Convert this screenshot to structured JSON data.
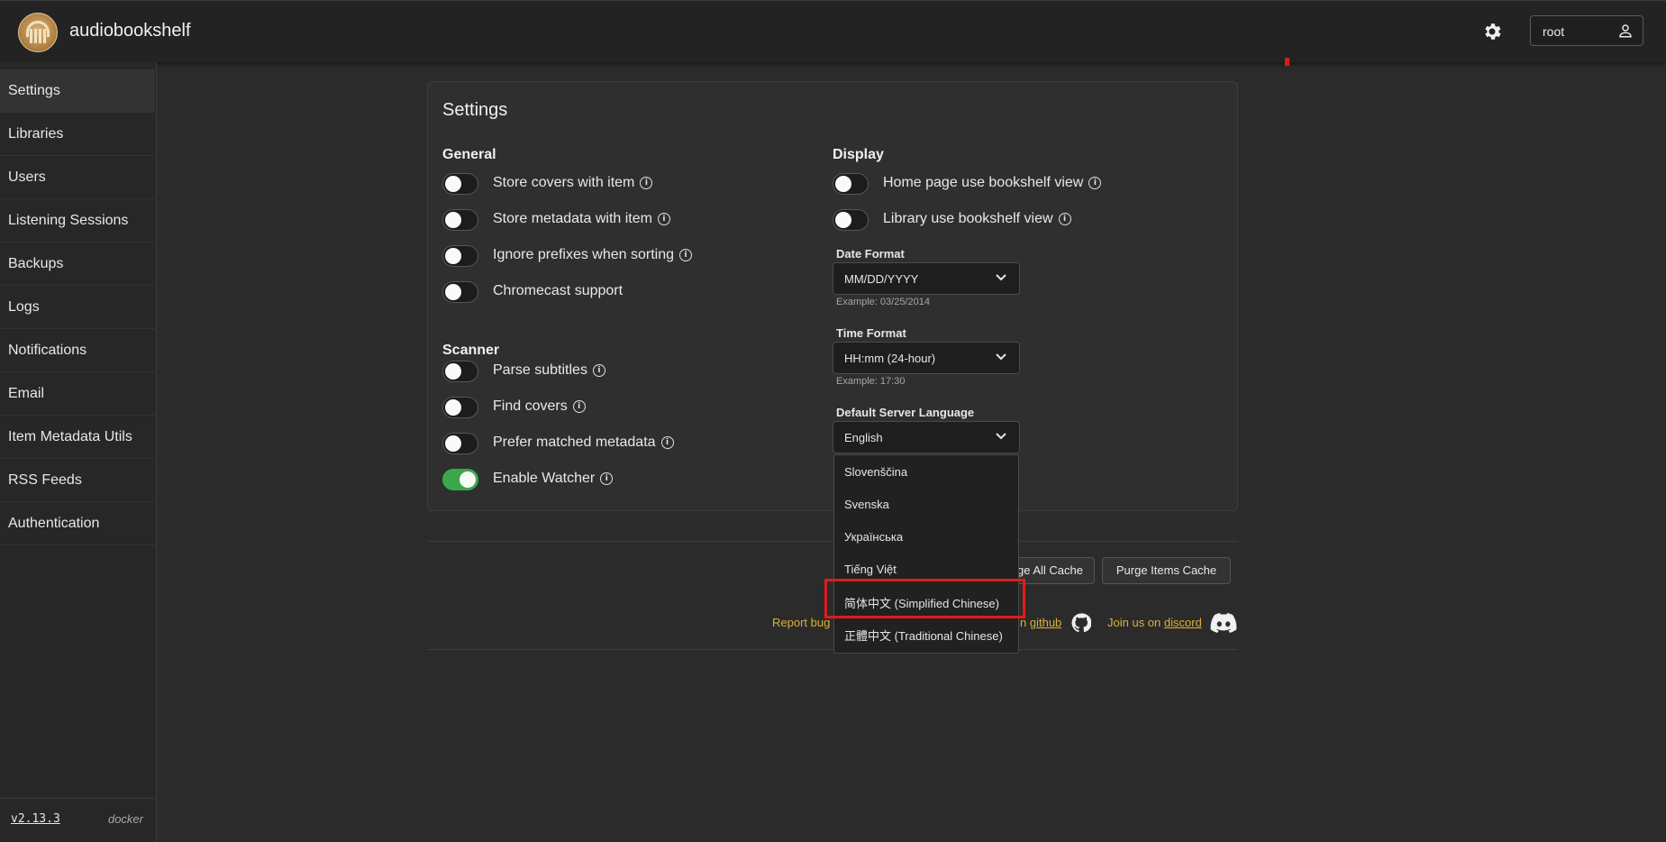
{
  "app": {
    "title": "audiobookshelf"
  },
  "header": {
    "username": "root",
    "settings_icon": "gear-icon",
    "user_icon": "user-icon"
  },
  "sidebar": {
    "items": [
      {
        "label": "Settings",
        "active": true
      },
      {
        "label": "Libraries"
      },
      {
        "label": "Users"
      },
      {
        "label": "Listening Sessions"
      },
      {
        "label": "Backups"
      },
      {
        "label": "Logs"
      },
      {
        "label": "Notifications"
      },
      {
        "label": "Email"
      },
      {
        "label": "Item Metadata Utils"
      },
      {
        "label": "RSS Feeds"
      },
      {
        "label": "Authentication"
      }
    ],
    "version": "v2.13.3",
    "install": "docker"
  },
  "settings": {
    "title": "Settings",
    "general": {
      "heading": "General",
      "items": [
        {
          "label": "Store covers with item",
          "on": false
        },
        {
          "label": "Store metadata with item",
          "on": false
        },
        {
          "label": "Ignore prefixes when sorting",
          "on": false
        },
        {
          "label": "Chromecast support",
          "on": false
        }
      ]
    },
    "scanner": {
      "heading": "Scanner",
      "items": [
        {
          "label": "Parse subtitles",
          "on": false
        },
        {
          "label": "Find covers",
          "on": false
        },
        {
          "label": "Prefer matched metadata",
          "on": false
        },
        {
          "label": "Enable Watcher",
          "on": true
        }
      ]
    },
    "display": {
      "heading": "Display",
      "items": [
        {
          "label": "Home page use bookshelf view",
          "on": false
        },
        {
          "label": "Library use bookshelf view",
          "on": false
        }
      ],
      "date_format": {
        "label": "Date Format",
        "value": "MM/DD/YYYY",
        "example": "Example: 03/25/2014"
      },
      "time_format": {
        "label": "Time Format",
        "value": "HH:mm (24-hour)",
        "example": "Example: 17:30"
      },
      "language": {
        "label": "Default Server Language",
        "value": "English",
        "options": [
          "Slovenščina",
          "Svenska",
          "Українська",
          "Tiếng Việt",
          "简体中文 (Simplified Chinese)",
          "正體中文 (Traditional Chinese)"
        ]
      }
    }
  },
  "actions": {
    "purge_all_partial": "ge All Cache",
    "purge_items": "Purge Items Cache"
  },
  "footer": {
    "report_partial": "Report bug",
    "github_prefix_partial": "n",
    "github_link": "github",
    "discord_prefix": "Join us on",
    "discord_link": "discord"
  },
  "colors": {
    "accent_toggle": "#3aa84a",
    "link": "#d8b13a",
    "highlight": "#e01b1b"
  }
}
